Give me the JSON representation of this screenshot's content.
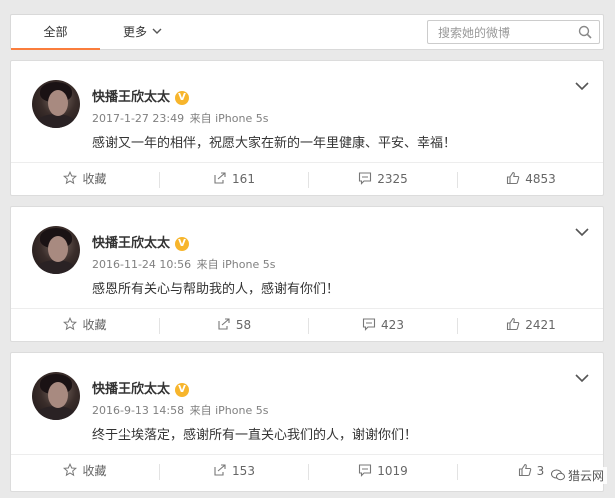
{
  "tabs": {
    "all": "全部",
    "more": "更多"
  },
  "search": {
    "placeholder": "搜索她的微博"
  },
  "posts": [
    {
      "author": "快播王欣太太",
      "date": "2017-1-27 23:49",
      "source": "来自 iPhone 5s",
      "text": "感谢又一年的相伴，祝愿大家在新的一年里健康、平安、幸福！",
      "favorite": "收藏",
      "reposts": "161",
      "comments": "2325",
      "likes": "4853"
    },
    {
      "author": "快播王欣太太",
      "date": "2016-11-24 10:56",
      "source": "来自 iPhone 5s",
      "text": "感恩所有关心与帮助我的人，感谢有你们！",
      "favorite": "收藏",
      "reposts": "58",
      "comments": "423",
      "likes": "2421"
    },
    {
      "author": "快播王欣太太",
      "date": "2016-9-13 14:58",
      "source": "来自 iPhone 5s",
      "text": "终于尘埃落定，感谢所有一直关心我们的人，谢谢你们！",
      "favorite": "收藏",
      "reposts": "153",
      "comments": "1019",
      "likes": "3"
    }
  ],
  "watermark": "猎云网",
  "colors": {
    "accent": "#fa7d3c",
    "verified": "#f7b52c",
    "background": "#e9e9e9"
  },
  "icons": [
    "chevron-down-icon",
    "search-icon",
    "star-icon",
    "repost-icon",
    "comment-icon",
    "like-icon"
  ]
}
